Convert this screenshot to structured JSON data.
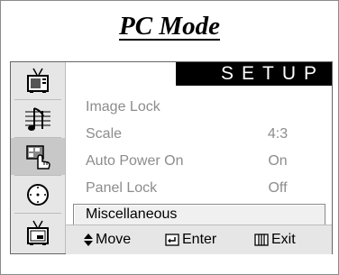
{
  "title": "PC Mode",
  "menu": {
    "header": "SETUP",
    "items": [
      {
        "label": "Image Lock",
        "value": ""
      },
      {
        "label": "Scale",
        "value": "4:3"
      },
      {
        "label": "Auto Power On",
        "value": "On"
      },
      {
        "label": "Panel Lock",
        "value": "Off"
      },
      {
        "label": "Miscellaneous",
        "value": ""
      }
    ],
    "selected_index": 4
  },
  "sidebar": {
    "icons": [
      "picture-icon",
      "sound-icon",
      "setup-icon",
      "timer-icon",
      "pip-icon"
    ],
    "active_index": 2
  },
  "footer": {
    "move_label": "Move",
    "enter_label": "Enter",
    "exit_label": "Exit"
  }
}
